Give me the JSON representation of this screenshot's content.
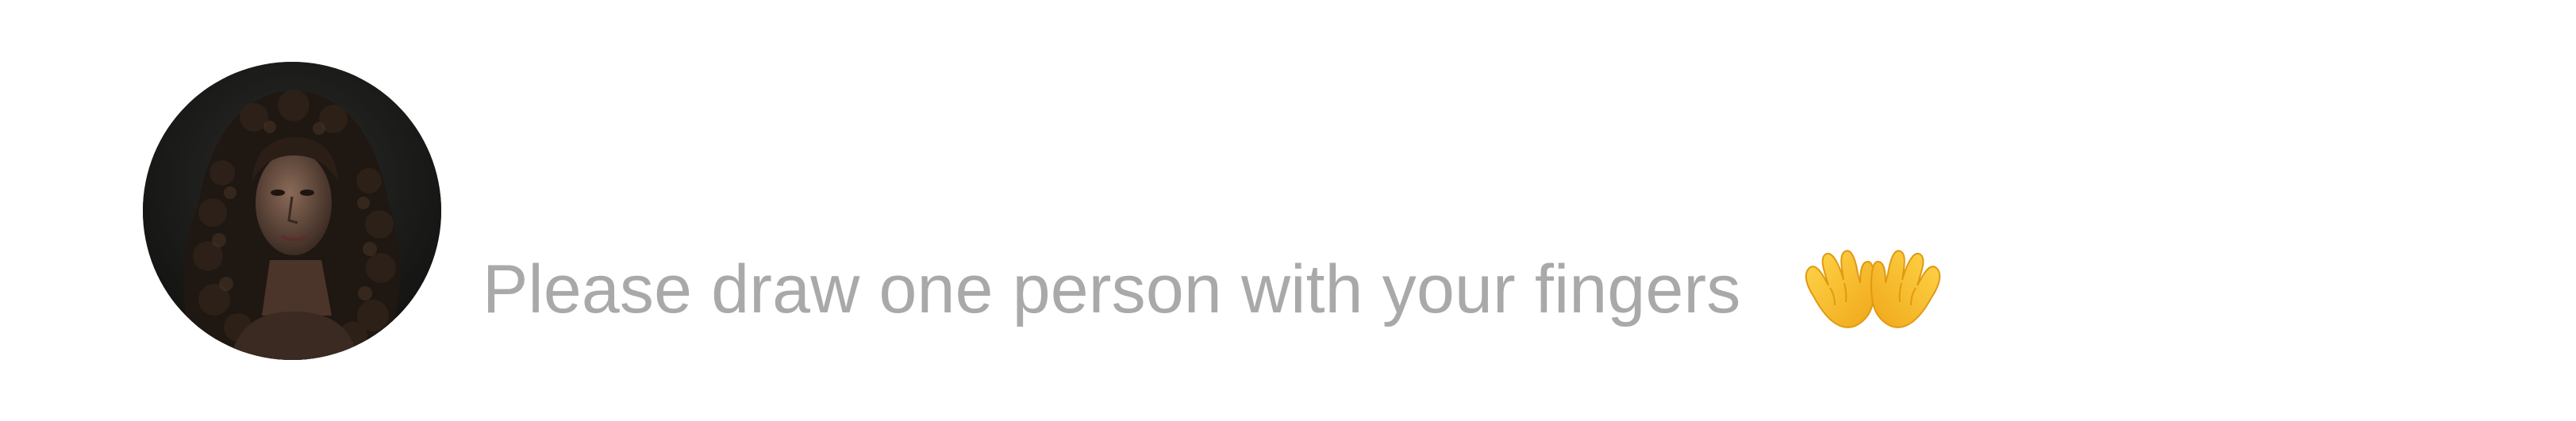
{
  "prompt": {
    "text": "Please draw one person with your fingers",
    "icon": "waving-hands-icon",
    "text_color": "#a9a9a9"
  },
  "avatar": {
    "icon": "profile-photo-icon"
  }
}
